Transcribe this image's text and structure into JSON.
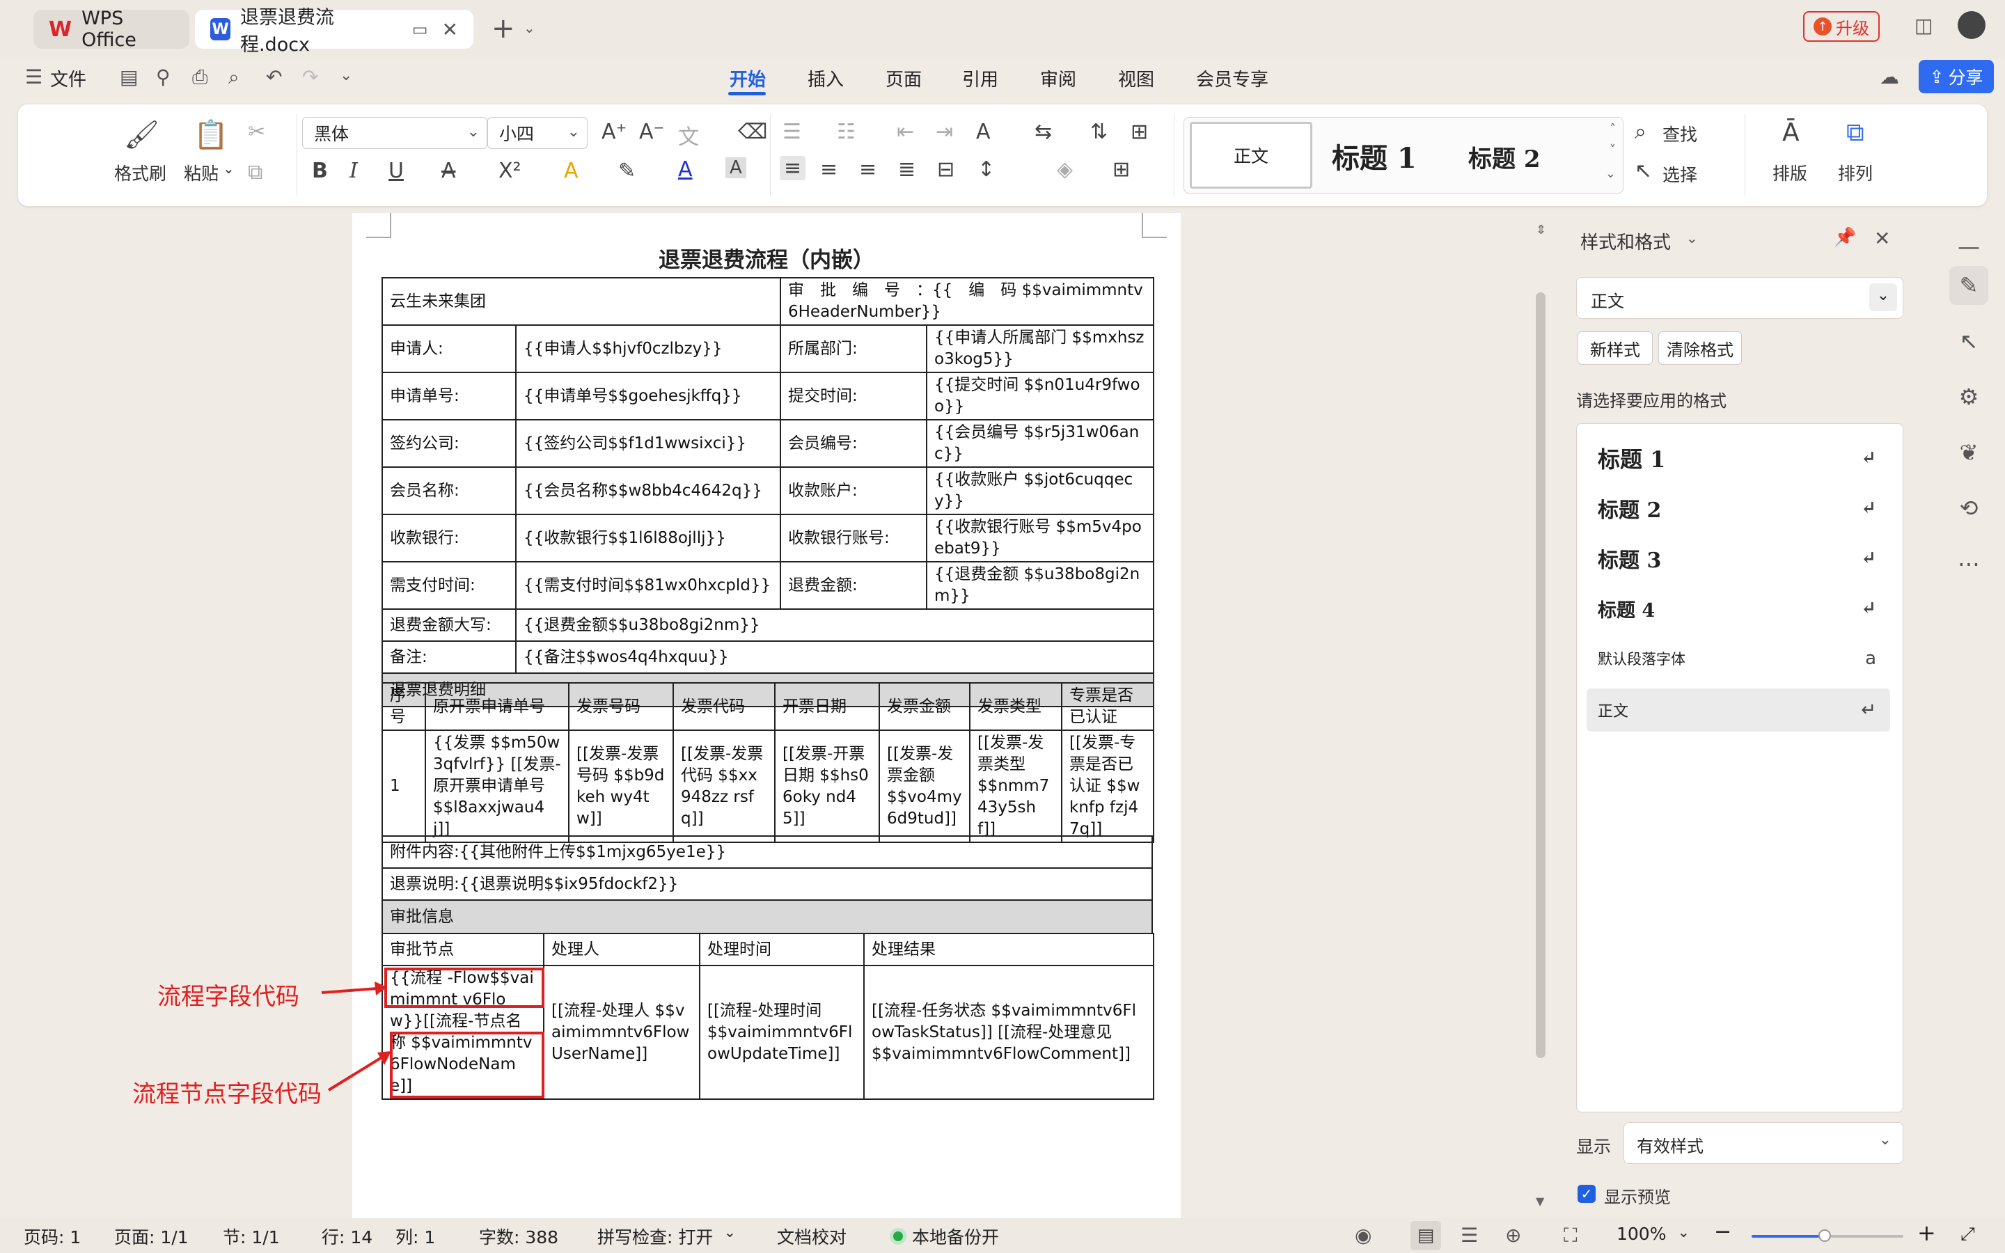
{
  "titlebar": {
    "app_tab": "WPS Office",
    "doc_tab": "退票退费流程.docx",
    "upgrade": "升级"
  },
  "menu": {
    "file": "文件",
    "items": [
      "开始",
      "插入",
      "页面",
      "引用",
      "审阅",
      "视图",
      "会员专享"
    ],
    "share": "分享"
  },
  "ribbon": {
    "format_painter": "格式刷",
    "paste": "粘贴",
    "font_name": "黑体",
    "font_size": "小四",
    "styles": [
      "正文",
      "标题 1",
      "标题 2"
    ],
    "find": "查找",
    "select": "选择",
    "layout": "排版",
    "arrange": "排列"
  },
  "document": {
    "title": "退票退费流程（内嵌）",
    "company": "云生未来集团",
    "approval_no": "审　批　编　号　：{{　编　码 $$vaimimmntv6HeaderNumber}}",
    "rows": [
      {
        "l1": "申请人:",
        "v1": "{{申请人$$hjvf0czlbzy}}",
        "l2": "所属部门:",
        "v2": "{{申请人所属部门 $$mxhszo3kog5}}"
      },
      {
        "l1": "申请单号:",
        "v1": "{{申请单号$$goehesjkffq}}",
        "l2": "提交时间:",
        "v2": "{{提交时间 $$n01u4r9fwoo}}"
      },
      {
        "l1": "签约公司:",
        "v1": "{{签约公司$$f1d1wwsixci}}",
        "l2": "会员编号:",
        "v2": "{{会员编号 $$r5j31w06anc}}"
      },
      {
        "l1": "会员名称:",
        "v1": "{{会员名称$$w8bb4c4642q}}",
        "l2": "收款账户:",
        "v2": "{{收款账户 $$jot6cuqqecy}}"
      },
      {
        "l1": "收款银行:",
        "v1": "{{收款银行$$1l6l88ojllj}}",
        "l2": "收款银行账号:",
        "v2": "{{收款银行账号 $$m5v4poebat9}}"
      },
      {
        "l1": "需支付时间:",
        "v1": "{{需支付时间$$81wx0hxcpld}}",
        "l2": "退费金额:",
        "v2": "{{退费金额 $$u38bo8gi2nm}}"
      }
    ],
    "amount_upper_label": "退费金额大写:",
    "amount_upper_value": "{{退费金额$$u38bo8gi2nm}}",
    "remark_label": "备注:",
    "remark_value": "{{备注$$wos4q4hxquu}}",
    "detail_section": "退票退费明细",
    "detail_headers": [
      "序号",
      "原开票申请单号",
      "发票号码",
      "发票代码",
      "开票日期",
      "发票金额",
      "发票类型",
      "专票是否已认证"
    ],
    "detail_row": [
      "1",
      "{{发票 $$m50w3qfvlrf}} [[发票-原开票申请单号 $$l8axxjwau4j]]",
      "[[发票-发票号码 $$b9dkeh wy4tw]]",
      "[[发票-发票代码 $$xx948zz rsfq]]",
      "[[发票-开票日期 $$hs06oky nd45]]",
      "[[发票-发票金额 $$vo4my 6d9tud]]",
      "[[发票-发票类型 $$nmm7 43y5shf]]",
      "[[发票-专票是否已认证 $$wknfp fzj47q]]"
    ],
    "attachments": "附件内容:{{其他附件上传$$1mjxg65ye1e}}",
    "refund_note": "退票说明:{{退票说明$$ix95fdockf2}}",
    "approval_section": "审批信息",
    "approval_headers": [
      "审批节点",
      "处理人",
      "处理时间",
      "处理结果"
    ],
    "approval_node": "{{流程 -Flow$$vaimimmnt v6Flow}}[[流程-节点名称 $$vaimimmntv6FlowNodeName]]",
    "approval_user": "[[流程-处理人 $$vaimimmntv6FlowUserName]]",
    "approval_time": "[[流程-处理时间 $$vaimimmntv6FlowUpdateTime]]",
    "approval_result": "[[流程-任务状态 $$vaimimmntv6FlowTaskStatus]] [[流程-处理意见 $$vaimimmntv6FlowComment]]"
  },
  "annotations": {
    "flow_field": "流程字段代码",
    "flow_node_field": "流程节点字段代码",
    "color": "#e02020"
  },
  "style_pane": {
    "title": "样式和格式",
    "current_style": "正文",
    "new_style": "新样式",
    "clear_format": "清除格式",
    "prompt": "请选择要应用的格式",
    "styles": [
      "标题 1",
      "标题 2",
      "标题 3",
      "标题 4",
      "默认段落字体",
      "正文"
    ],
    "show_label": "显示",
    "show_value": "有效样式",
    "preview_label": "显示预览"
  },
  "statusbar": {
    "page_no": "页码: 1",
    "pages": "页面: 1/1",
    "section": "节: 1/1",
    "row": "行: 14",
    "col": "列: 1",
    "word_count": "字数: 388",
    "spell_check": "拼写检查: 打开",
    "proofread": "文档校对",
    "backup": "本地备份开",
    "zoom": "100%"
  },
  "colors": {
    "accent": "#1f5fe0",
    "share_button": "#2f6bf0",
    "upgrade": "#e0332c"
  }
}
